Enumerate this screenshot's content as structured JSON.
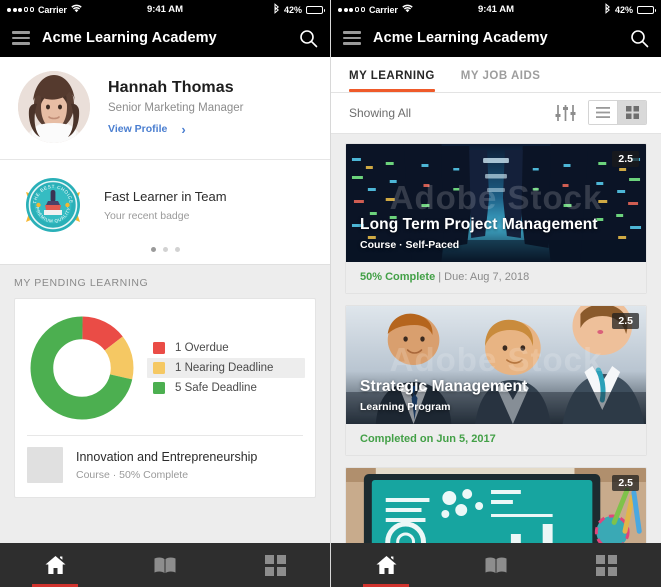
{
  "status_bar": {
    "carrier": "Carrier",
    "time": "9:41 AM",
    "battery_percent": "42%",
    "wifi_icon": "wifi-icon",
    "bluetooth_icon": "bluetooth-icon",
    "battery_icon": "battery-icon",
    "battery_level": 42
  },
  "app_bar": {
    "title": "Acme Learning Academy",
    "menu_icon": "hamburger-menu-icon",
    "search_icon": "search-icon"
  },
  "profile": {
    "name": "Hannah Thomas",
    "role": "Senior Marketing Manager",
    "view_profile_label": "View Profile",
    "chevron_icon": "chevron-right-icon",
    "avatar_icon": "user-avatar"
  },
  "badge": {
    "title": "Fast Learner in Team",
    "subtitle": "Your recent badge",
    "badge_icon": "award-badge-icon",
    "badge_ring_text_top": "THE BEST CHOICE",
    "badge_ring_text_bottom": "PREMIUM QUALITY",
    "carousel": {
      "count": 3,
      "active_index": 0
    }
  },
  "pending": {
    "heading": "MY PENDING LEARNING",
    "item": {
      "title": "Innovation and Entrepreneurship",
      "meta": "Course · 50% Complete",
      "thumbnail_icon": "course-thumbnail"
    }
  },
  "chart_data": {
    "type": "pie",
    "title": "MY PENDING LEARNING",
    "categories": [
      "Overdue",
      "Nearing Deadline",
      "Safe Deadline"
    ],
    "values": [
      1,
      1,
      5
    ],
    "labels": [
      "1 Overdue",
      "1 Nearing Deadline",
      "5 Safe Deadline"
    ],
    "colors": [
      "#ea4c46",
      "#f5c863",
      "#4caf50"
    ],
    "total": 7,
    "donut": true,
    "inner_radius_ratio": 0.56,
    "start_angle_deg": 0,
    "legend_position": "right",
    "highlighted_index": 1
  },
  "learning": {
    "tabs": [
      {
        "label": "MY LEARNING",
        "active": true
      },
      {
        "label": "MY JOB AIDS",
        "active": false
      }
    ],
    "filter": {
      "showing_label": "Showing All",
      "sliders_icon": "filter-sliders-icon",
      "list_view_icon": "list-view-icon",
      "grid_view_icon": "grid-view-icon",
      "active_view": "grid"
    },
    "courses": [
      {
        "title": "Long Term Project Management",
        "subtitle": "Course · Self-Paced",
        "rating": "2.5",
        "progress_label": "50% Complete",
        "due_label": " | Due: Aug 7, 2018",
        "watermark": "Adobe Stock",
        "image_icon": "data-center-image"
      },
      {
        "title": "Strategic Management",
        "subtitle": "Learning Program",
        "rating": "2.5",
        "progress_label": "Completed on Jun 5, 2017",
        "due_label": "",
        "watermark": "Adobe Stock",
        "image_icon": "business-meeting-image"
      },
      {
        "title": "",
        "subtitle": "",
        "rating": "2.5",
        "progress_label": "",
        "due_label": "",
        "watermark": "",
        "image_icon": "tablet-infographic-image"
      }
    ]
  },
  "bottom_nav": {
    "items": [
      {
        "icon": "home-icon",
        "active": true
      },
      {
        "icon": "book-icon",
        "active": false
      },
      {
        "icon": "grid-icon",
        "active": false
      }
    ]
  },
  "colors": {
    "accent_orange": "#ef5a2a",
    "accent_red": "#d0332e",
    "link_blue": "#4a7ed0",
    "green": "#43a047",
    "overdue": "#ea4c46",
    "nearing": "#f5c863",
    "safe": "#4caf50"
  }
}
